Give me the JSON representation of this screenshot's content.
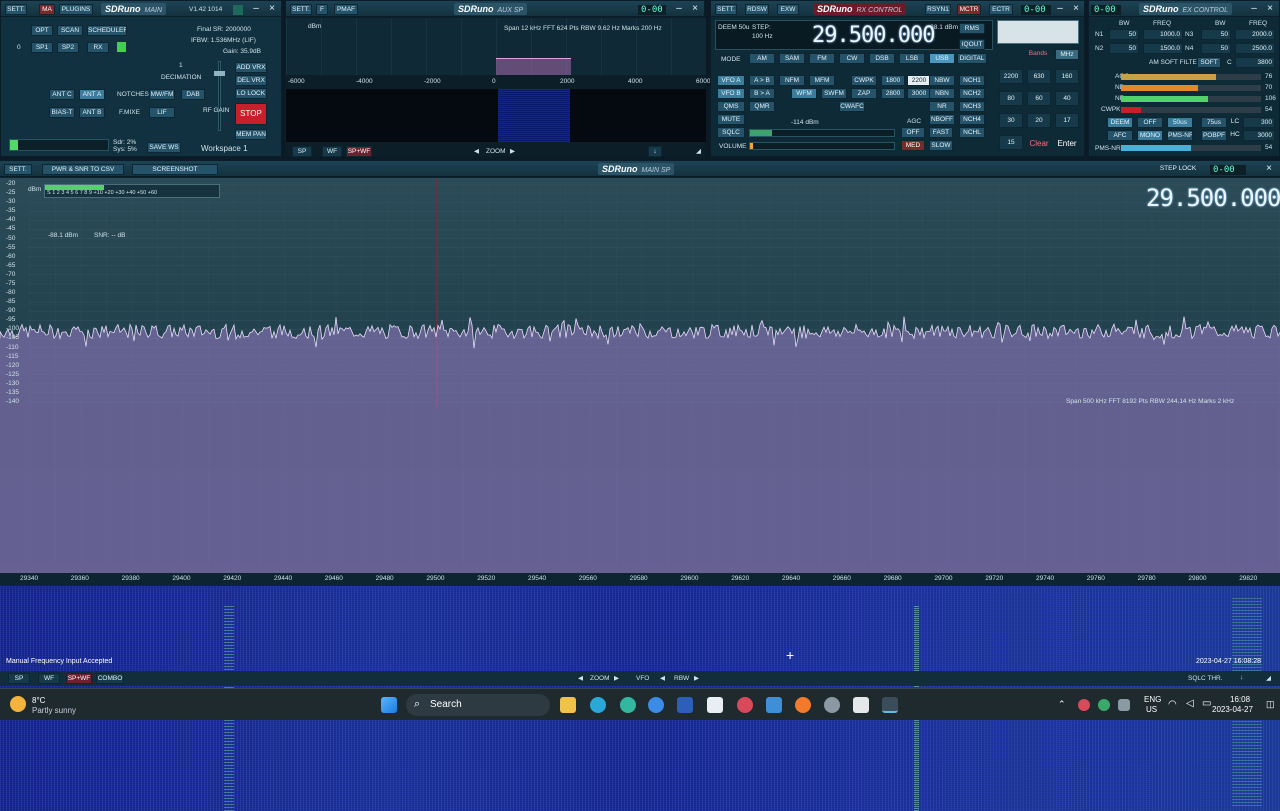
{
  "main_panel": {
    "tabs": [
      "SETT.",
      "MA",
      "PLUGINS"
    ],
    "logo": "SDRuno",
    "logo_sub": "MAIN",
    "version": "V1.42 1014",
    "buttons": [
      "OPT",
      "SCAN",
      "SCHEDULER",
      "SP1",
      "SP2",
      "RX"
    ],
    "zero_label": "0",
    "sr_line1": "Final SR: 2000000",
    "sr_line2": "IFBW: 1.536MHz (LIF)",
    "sr_line3": "Gain: 35.9dB",
    "decimation_label": "DECIMATION",
    "decimation_value": "1",
    "ant_buttons": [
      "ANT C",
      "ANT A",
      "NOTCHES",
      "MW/FM",
      "DAB",
      "BIAS-T",
      "ANT B",
      "F.MIXE",
      "LIF"
    ],
    "side_buttons": [
      "ADD VRX",
      "DEL VRX",
      "LO LOCK"
    ],
    "rf_gain": "RF GAIN",
    "stop": "STOP",
    "mem_pan": "MEM PAN",
    "sdr_load": "Sdr: 2%",
    "sys_load": "Sys: 5%",
    "save_ws": "SAVE WS",
    "workspace": "Workspace 1"
  },
  "aux_panel": {
    "tabs": [
      "SETT.",
      "F",
      "PMAF"
    ],
    "logo": "SDRuno",
    "logo_sub": "AUX SP",
    "info": "Span 12 kHz  FFT 624 Pts  RBW 9.62 Hz  Marks 200 Hz",
    "dbm": "dBm",
    "x_ticks": [
      "-6000",
      "-4000",
      "-2000",
      "0",
      "2000",
      "4000",
      "6000"
    ],
    "bottom_buttons": [
      "SP",
      "WF",
      "SP+WF"
    ],
    "zoom": "ZOOM",
    "lcd": "0-00"
  },
  "rx_panel": {
    "tabs": [
      "SETT.",
      "RDSW",
      "EXW"
    ],
    "logo": "SDRuno",
    "logo_sub": "RX CONTROL",
    "tabs_right": [
      "RSYN1",
      "MCTR",
      "ECTR"
    ],
    "deem": "DEEM 50u",
    "step_label": "STEP:",
    "step_value": "100 Hz",
    "frequency": "29.500.000",
    "dbm_readout": "-88.1 dBm",
    "rms": "RMS",
    "iq_out": "IQOUT",
    "digital": "DIGITAL",
    "mode_label": "MODE",
    "modes": [
      "AM",
      "SAM",
      "FM",
      "CW",
      "DSB",
      "LSB",
      "USB"
    ],
    "vfo_a": "VFO A",
    "vfo_b": "VFO B",
    "a_b": "A > B",
    "b_a": "B > A",
    "fm_mode": [
      "NFM",
      "MFM",
      "WFM",
      "SWFM"
    ],
    "cw_op": [
      "CWPK",
      "ZAP",
      "CWAFC"
    ],
    "filter": [
      "1800",
      "2200",
      "2800",
      "3000"
    ],
    "nr": [
      "NBW",
      "NBN",
      "NR",
      "NBOFF"
    ],
    "notch": [
      "NCH1",
      "NCH2",
      "NCH3",
      "NCH4"
    ],
    "qms": "QMS",
    "qmr": "QMR",
    "mute": "MUTE",
    "sqlc": "SQLC",
    "squelch_db": "-114 dBm",
    "agc": "AGC",
    "agc_buttons": [
      "OFF",
      "MED",
      "FAST",
      "SLOW"
    ],
    "nchl": "NCHL",
    "volume": "VOLUME",
    "keypad": [
      "Bands",
      "MHz",
      "2200",
      "630",
      "160",
      "80",
      "60",
      "40",
      "30",
      "20",
      "17",
      "15",
      "Clear",
      "Enter"
    ]
  },
  "ex_panel": {
    "logo": "SDRuno",
    "logo_sub": "EX CONTROL",
    "labels": [
      "BW",
      "FREQ",
      "BW",
      "FREQ"
    ],
    "n1": "N1",
    "n2": "N2",
    "n3": "N3",
    "n4": "N4",
    "n1_bw": "50",
    "n1_freq": "1000.0",
    "n2_bw": "50",
    "n2_freq": "1500.0",
    "n3_bw": "50",
    "n3_freq": "2000.0",
    "n4_bw": "50",
    "n4_freq": "2500.0",
    "am_soft": "AM SOFT FILTER",
    "soft": "SOFT",
    "c_label": "C",
    "c_value": "3800",
    "rows": [
      "AGC",
      "NB",
      "NR",
      "CWPK"
    ],
    "row_values": [
      "76",
      "70",
      "106",
      "54"
    ],
    "fm_buttons": [
      "DEEM",
      "OFF",
      "50us",
      "75us",
      "LC"
    ],
    "afc_buttons": [
      "AFC",
      "MONO",
      "PMS-NR",
      "POBPF",
      "HC"
    ],
    "lc_value": "300",
    "hc_value": "3000",
    "pms_nr": "PMS-NR",
    "pms_value": "54"
  },
  "main_sp": {
    "tabs": [
      "SETT.",
      "PWR & SNR TO CSV",
      "SCREENSHOT"
    ],
    "logo": "SDRuno",
    "logo_sub": "MAIN SP",
    "step_lock": "STEP LOCK",
    "lcd": "0-00",
    "big_freq": "29.500.000",
    "smeter_scale": "S 1 2 3 4 5 6 7 8 9 +10 +20 +30 +40 +50 +60",
    "dbm_readout": "-88.1 dBm",
    "snr": "SNR: -- dB",
    "dbm": "dBm",
    "y_ticks": [
      "-20",
      "-25",
      "-30",
      "-35",
      "-40",
      "-45",
      "-50",
      "-55",
      "-60",
      "-65",
      "-70",
      "-75",
      "-80",
      "-85",
      "-90",
      "-95",
      "-100",
      "-105",
      "-110",
      "-115",
      "-120",
      "-125",
      "-130",
      "-135",
      "-140"
    ],
    "x_ticks": [
      "29340",
      "29360",
      "29380",
      "29400",
      "29420",
      "29440",
      "29460",
      "29480",
      "29500",
      "29520",
      "29540",
      "29560",
      "29580",
      "29600",
      "29620",
      "29640",
      "29660",
      "29680",
      "29700",
      "29720",
      "29740",
      "29760",
      "29780",
      "29800",
      "29820"
    ],
    "span_info": "Span 500 kHz  FFT 8192 Pts  RBW 244.14 Hz  Marks 2 kHz",
    "status": "Manual Frequency Input Accepted",
    "datetime": "2023-04-27 16:08:28",
    "bottom_buttons": [
      "SP",
      "WF",
      "SP+WF",
      "COMBO"
    ],
    "zoom": "ZOOM",
    "vfo": "VFO",
    "rbw": "RBW",
    "sqlc_thr": "SQLC THR."
  },
  "taskbar": {
    "weather_temp": "8°C",
    "weather_desc": "Partly sunny",
    "search": "Search",
    "lang": "ENG",
    "region": "US",
    "time": "16:08",
    "date": "2023-04-27"
  }
}
